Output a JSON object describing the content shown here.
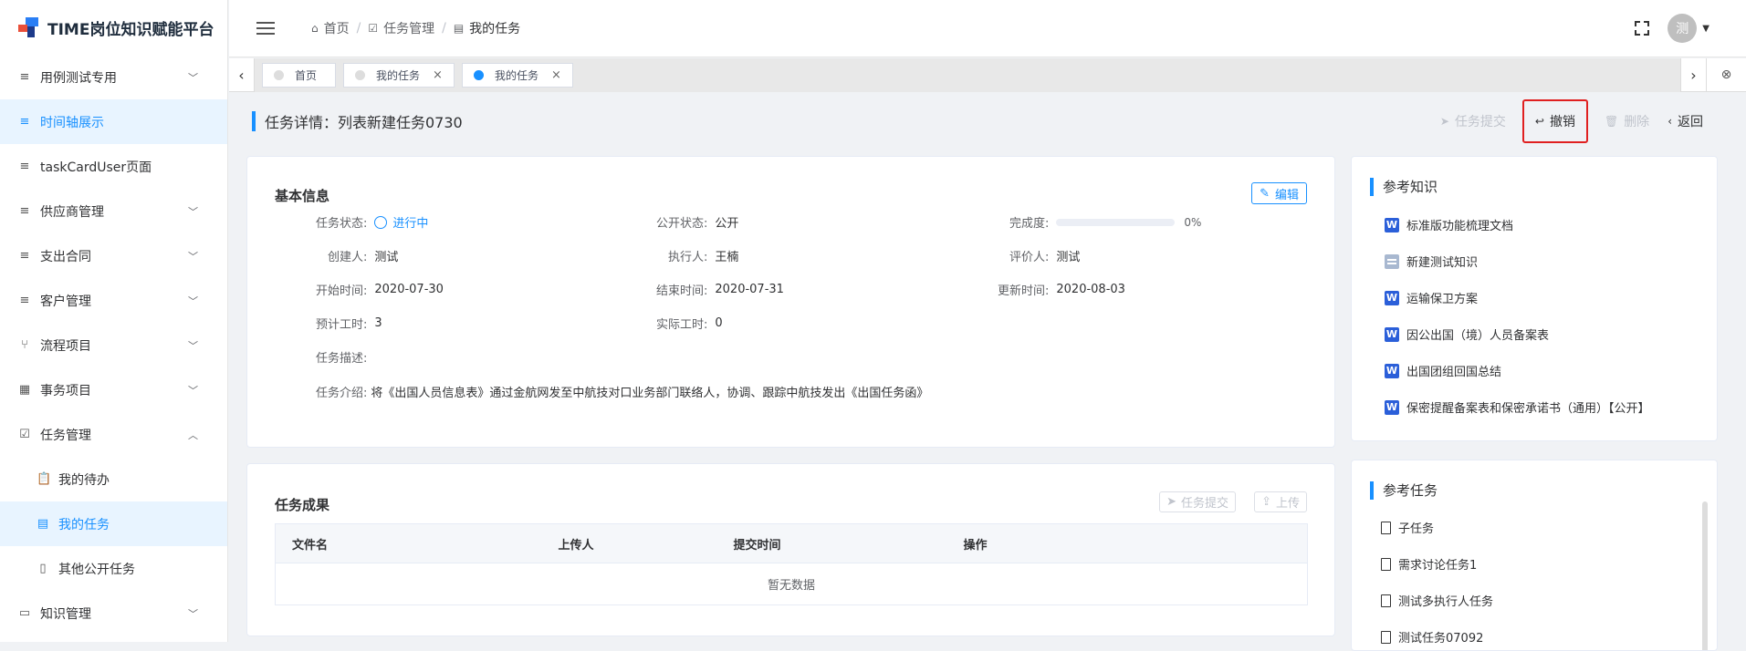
{
  "app": {
    "title": "TIME岗位知识赋能平台"
  },
  "sidebar": {
    "items": [
      {
        "label": "用例测试专用",
        "icon": "menu-icon",
        "arrow": "⌄"
      },
      {
        "label": "时间轴展示",
        "icon": "menu-icon",
        "active": true
      },
      {
        "label": "taskCardUser页面",
        "icon": "menu-icon"
      },
      {
        "label": "供应商管理",
        "icon": "menu-icon",
        "arrow": "⌄"
      },
      {
        "label": "支出合同",
        "icon": "menu-icon",
        "arrow": "⌄"
      },
      {
        "label": "客户管理",
        "icon": "menu-icon",
        "arrow": "⌄"
      },
      {
        "label": "流程项目",
        "icon": "branch-icon",
        "arrow": "⌄"
      },
      {
        "label": "事务项目",
        "icon": "grid-icon",
        "arrow": "⌄"
      },
      {
        "label": "任务管理",
        "icon": "checkbox-icon",
        "arrow": "⌃"
      },
      {
        "label": "我的待办",
        "icon": "clipboard-icon",
        "sub": true
      },
      {
        "label": "我的任务",
        "icon": "task-icon",
        "sub": true,
        "active": true
      },
      {
        "label": "其他公开任务",
        "icon": "doc-icon",
        "sub": true
      },
      {
        "label": "知识管理",
        "icon": "book-icon",
        "arrow": "⌄"
      }
    ]
  },
  "breadcrumb": {
    "home": "首页",
    "mid": "任务管理",
    "current": "我的任务"
  },
  "header": {
    "avatar_text": "测"
  },
  "tabs": [
    {
      "label": "首页",
      "active": false,
      "closable": false
    },
    {
      "label": "我的任务",
      "active": false,
      "closable": true
    },
    {
      "label": "我的任务",
      "active": true,
      "closable": true
    }
  ],
  "page": {
    "title": "任务详情：列表新建任务0730",
    "actions": {
      "submit": "任务提交",
      "undo": "撤销",
      "delete": "删除",
      "back": "返回"
    }
  },
  "basic": {
    "title": "基本信息",
    "edit": "编辑",
    "status_label": "任务状态:",
    "status_value": "进行中",
    "public_label": "公开状态:",
    "public_value": "公开",
    "progress_label": "完成度:",
    "progress_fraction": 0,
    "progress_text": "0%",
    "creator_label": "创建人:",
    "creator_value": "测试",
    "executor_label": "执行人:",
    "executor_value": "王楠",
    "reviewer_label": "评价人:",
    "reviewer_value": "测试",
    "start_label": "开始时间:",
    "start_value": "2020-07-30",
    "end_label": "结束时间:",
    "end_value": "2020-07-31",
    "update_label": "更新时间:",
    "update_value": "2020-08-03",
    "est_label": "预计工时:",
    "est_value": "3",
    "actual_label": "实际工时:",
    "actual_value": "0",
    "desc_label": "任务描述:",
    "intro_label": "任务介绍:",
    "intro_value": "将《出国人员信息表》通过金航网发至中航技对口业务部门联络人，协调、跟踪中航技发出《出国任务函》"
  },
  "results": {
    "title": "任务成果",
    "submit": "任务提交",
    "upload": "上传",
    "columns": [
      "文件名",
      "上传人",
      "提交时间",
      "操作"
    ],
    "empty": "暂无数据"
  },
  "ref_knowledge": {
    "title": "参考知识",
    "items": [
      {
        "label": "标准版功能梳理文档",
        "type": "word"
      },
      {
        "label": "新建测试知识",
        "type": "text"
      },
      {
        "label": "运输保卫方案",
        "type": "word"
      },
      {
        "label": "因公出国（境）人员备案表",
        "type": "word"
      },
      {
        "label": "出国团组回国总结",
        "type": "word"
      },
      {
        "label": "保密提醒备案表和保密承诺书（通用）【公开】",
        "type": "word"
      }
    ]
  },
  "ref_tasks": {
    "title": "参考任务",
    "items": [
      "子任务",
      "需求讨论任务1",
      "测试多执行人任务",
      "测试任务07092"
    ]
  }
}
